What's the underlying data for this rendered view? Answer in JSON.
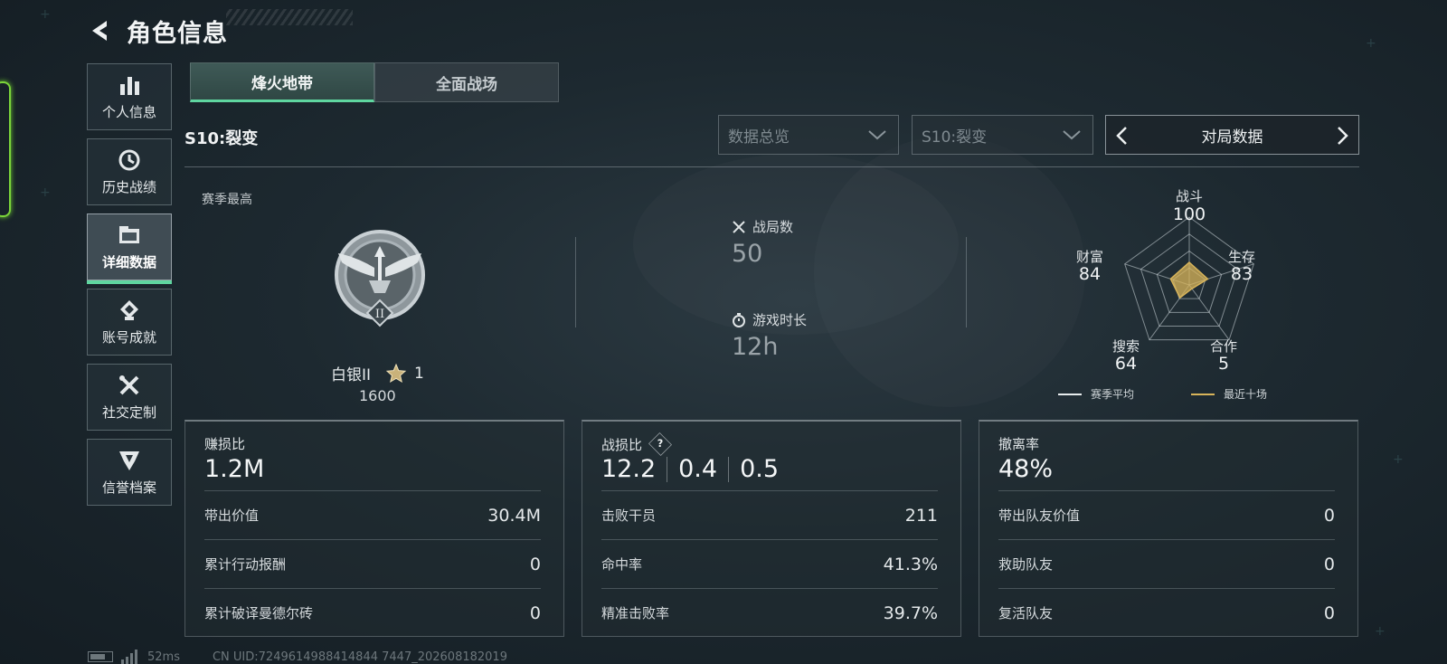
{
  "header": {
    "title": "角色信息"
  },
  "sidebar": {
    "items": [
      {
        "label": "个人信息",
        "icon": "bar-chart-icon"
      },
      {
        "label": "历史战绩",
        "icon": "history-icon"
      },
      {
        "label": "详细数据",
        "icon": "folder-icon",
        "active": true
      },
      {
        "label": "账号成就",
        "icon": "achievement-icon"
      },
      {
        "label": "社交定制",
        "icon": "tools-icon"
      },
      {
        "label": "信誉档案",
        "icon": "reputation-icon"
      }
    ]
  },
  "mode_tabs": [
    {
      "label": "烽火地带",
      "active": true
    },
    {
      "label": "全面战场",
      "active": false
    }
  ],
  "season": {
    "label": "S10:裂变"
  },
  "filters": {
    "overview": "数据总览",
    "season": "S10:裂变",
    "pager_label": "对局数据"
  },
  "season_best": {
    "label": "赛季最高",
    "rank": "白银II",
    "stars": "1",
    "score": "1600",
    "medal_numeral": "II"
  },
  "stats": {
    "matches_label": "战局数",
    "matches_value": "50",
    "playtime_label": "游戏时长",
    "playtime_value": "12h"
  },
  "radar": {
    "axes": [
      {
        "label": "战斗",
        "value": "100"
      },
      {
        "label": "生存",
        "value": "83"
      },
      {
        "label": "合作",
        "value": "5"
      },
      {
        "label": "搜索",
        "value": "64"
      },
      {
        "label": "财富",
        "value": "84"
      }
    ],
    "legend": [
      {
        "label": "赛季平均",
        "color": "#e8ecee"
      },
      {
        "label": "最近十场",
        "color": "#d8b45a"
      }
    ],
    "recent_color": "#d8b45a"
  },
  "panels": [
    {
      "title": "赚损比",
      "main": "1.2M",
      "rows": [
        {
          "label": "带出价值",
          "value": "30.4M"
        },
        {
          "label": "累计行动报酬",
          "value": "0"
        },
        {
          "label": "累计破译曼德尔砖",
          "value": "0"
        }
      ]
    },
    {
      "title": "战损比",
      "help": "?",
      "main_parts": [
        "12.2",
        "0.4",
        "0.5"
      ],
      "rows": [
        {
          "label": "击败干员",
          "value": "211"
        },
        {
          "label": "命中率",
          "value": "41.3%"
        },
        {
          "label": "精准击败率",
          "value": "39.7%"
        }
      ]
    },
    {
      "title": "撤离率",
      "main": "48%",
      "rows": [
        {
          "label": "带出队友价值",
          "value": "0"
        },
        {
          "label": "救助队友",
          "value": "0"
        },
        {
          "label": "复活队友",
          "value": "0"
        }
      ]
    }
  ],
  "footer": {
    "ping": "52ms",
    "uid": "CN UID:7249614988414844 7447_202608182019"
  },
  "colors": {
    "accent": "#5fd6a0",
    "edge": "#7bd53a"
  }
}
